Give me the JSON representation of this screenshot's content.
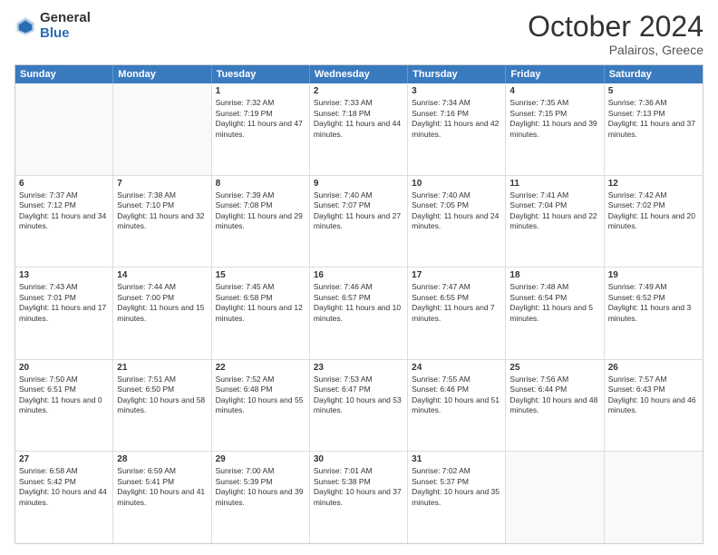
{
  "logo": {
    "general": "General",
    "blue": "Blue"
  },
  "header": {
    "month": "October 2024",
    "location": "Palairos, Greece"
  },
  "weekdays": [
    "Sunday",
    "Monday",
    "Tuesday",
    "Wednesday",
    "Thursday",
    "Friday",
    "Saturday"
  ],
  "rows": [
    [
      {
        "day": "",
        "text": ""
      },
      {
        "day": "",
        "text": ""
      },
      {
        "day": "1",
        "text": "Sunrise: 7:32 AM\nSunset: 7:19 PM\nDaylight: 11 hours and 47 minutes."
      },
      {
        "day": "2",
        "text": "Sunrise: 7:33 AM\nSunset: 7:18 PM\nDaylight: 11 hours and 44 minutes."
      },
      {
        "day": "3",
        "text": "Sunrise: 7:34 AM\nSunset: 7:16 PM\nDaylight: 11 hours and 42 minutes."
      },
      {
        "day": "4",
        "text": "Sunrise: 7:35 AM\nSunset: 7:15 PM\nDaylight: 11 hours and 39 minutes."
      },
      {
        "day": "5",
        "text": "Sunrise: 7:36 AM\nSunset: 7:13 PM\nDaylight: 11 hours and 37 minutes."
      }
    ],
    [
      {
        "day": "6",
        "text": "Sunrise: 7:37 AM\nSunset: 7:12 PM\nDaylight: 11 hours and 34 minutes."
      },
      {
        "day": "7",
        "text": "Sunrise: 7:38 AM\nSunset: 7:10 PM\nDaylight: 11 hours and 32 minutes."
      },
      {
        "day": "8",
        "text": "Sunrise: 7:39 AM\nSunset: 7:08 PM\nDaylight: 11 hours and 29 minutes."
      },
      {
        "day": "9",
        "text": "Sunrise: 7:40 AM\nSunset: 7:07 PM\nDaylight: 11 hours and 27 minutes."
      },
      {
        "day": "10",
        "text": "Sunrise: 7:40 AM\nSunset: 7:05 PM\nDaylight: 11 hours and 24 minutes."
      },
      {
        "day": "11",
        "text": "Sunrise: 7:41 AM\nSunset: 7:04 PM\nDaylight: 11 hours and 22 minutes."
      },
      {
        "day": "12",
        "text": "Sunrise: 7:42 AM\nSunset: 7:02 PM\nDaylight: 11 hours and 20 minutes."
      }
    ],
    [
      {
        "day": "13",
        "text": "Sunrise: 7:43 AM\nSunset: 7:01 PM\nDaylight: 11 hours and 17 minutes."
      },
      {
        "day": "14",
        "text": "Sunrise: 7:44 AM\nSunset: 7:00 PM\nDaylight: 11 hours and 15 minutes."
      },
      {
        "day": "15",
        "text": "Sunrise: 7:45 AM\nSunset: 6:58 PM\nDaylight: 11 hours and 12 minutes."
      },
      {
        "day": "16",
        "text": "Sunrise: 7:46 AM\nSunset: 6:57 PM\nDaylight: 11 hours and 10 minutes."
      },
      {
        "day": "17",
        "text": "Sunrise: 7:47 AM\nSunset: 6:55 PM\nDaylight: 11 hours and 7 minutes."
      },
      {
        "day": "18",
        "text": "Sunrise: 7:48 AM\nSunset: 6:54 PM\nDaylight: 11 hours and 5 minutes."
      },
      {
        "day": "19",
        "text": "Sunrise: 7:49 AM\nSunset: 6:52 PM\nDaylight: 11 hours and 3 minutes."
      }
    ],
    [
      {
        "day": "20",
        "text": "Sunrise: 7:50 AM\nSunset: 6:51 PM\nDaylight: 11 hours and 0 minutes."
      },
      {
        "day": "21",
        "text": "Sunrise: 7:51 AM\nSunset: 6:50 PM\nDaylight: 10 hours and 58 minutes."
      },
      {
        "day": "22",
        "text": "Sunrise: 7:52 AM\nSunset: 6:48 PM\nDaylight: 10 hours and 55 minutes."
      },
      {
        "day": "23",
        "text": "Sunrise: 7:53 AM\nSunset: 6:47 PM\nDaylight: 10 hours and 53 minutes."
      },
      {
        "day": "24",
        "text": "Sunrise: 7:55 AM\nSunset: 6:46 PM\nDaylight: 10 hours and 51 minutes."
      },
      {
        "day": "25",
        "text": "Sunrise: 7:56 AM\nSunset: 6:44 PM\nDaylight: 10 hours and 48 minutes."
      },
      {
        "day": "26",
        "text": "Sunrise: 7:57 AM\nSunset: 6:43 PM\nDaylight: 10 hours and 46 minutes."
      }
    ],
    [
      {
        "day": "27",
        "text": "Sunrise: 6:58 AM\nSunset: 5:42 PM\nDaylight: 10 hours and 44 minutes."
      },
      {
        "day": "28",
        "text": "Sunrise: 6:59 AM\nSunset: 5:41 PM\nDaylight: 10 hours and 41 minutes."
      },
      {
        "day": "29",
        "text": "Sunrise: 7:00 AM\nSunset: 5:39 PM\nDaylight: 10 hours and 39 minutes."
      },
      {
        "day": "30",
        "text": "Sunrise: 7:01 AM\nSunset: 5:38 PM\nDaylight: 10 hours and 37 minutes."
      },
      {
        "day": "31",
        "text": "Sunrise: 7:02 AM\nSunset: 5:37 PM\nDaylight: 10 hours and 35 minutes."
      },
      {
        "day": "",
        "text": ""
      },
      {
        "day": "",
        "text": ""
      }
    ]
  ]
}
